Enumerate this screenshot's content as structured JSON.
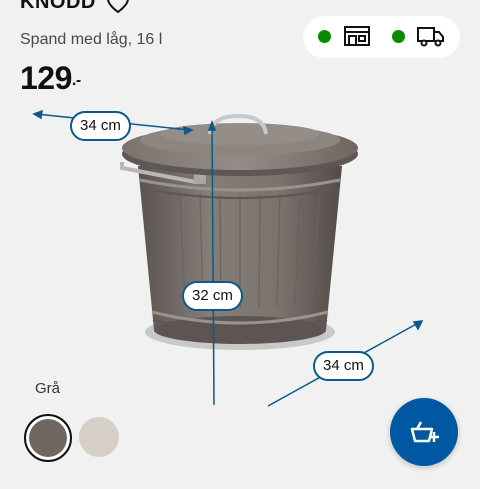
{
  "product": {
    "name": "KNODD",
    "description": "Spand med låg, 16 l",
    "price": "129",
    "price_suffix": ".-"
  },
  "dimensions": {
    "width_label": "34 cm",
    "height_label": "32 cm",
    "depth_label": "34 cm"
  },
  "color": {
    "label": "Grå",
    "options": [
      {
        "name": "grey",
        "hex": "#6e6660",
        "selected": true
      },
      {
        "name": "beige",
        "hex": "#d6cfc5",
        "selected": false
      }
    ]
  },
  "availability": {
    "store_icon": "store-icon",
    "delivery_icon": "truck-icon",
    "status_color": "#0a8a00"
  },
  "accent_color": "#0058a3"
}
